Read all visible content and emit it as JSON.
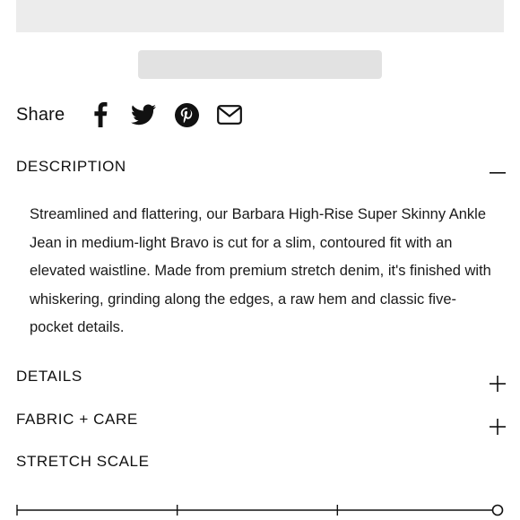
{
  "share": {
    "label": "Share",
    "icons": [
      "facebook-icon",
      "twitter-icon",
      "pinterest-icon",
      "email-icon"
    ]
  },
  "sections": {
    "description": {
      "title": "DESCRIPTION",
      "state": "expanded",
      "toggle_icon": "minus-icon",
      "body": "Streamlined and flattering, our Barbara High-Rise Super Skinny Ankle Jean in medium-light Bravo is cut for a slim, contoured fit with an elevated waistline. Made from premium stretch denim, it's finished with whiskering, grinding along the edges, a raw hem and classic five-pocket details."
    },
    "details": {
      "title": "DETAILS",
      "state": "collapsed",
      "toggle_icon": "plus-icon"
    },
    "fabric_care": {
      "title": "FABRIC + CARE",
      "state": "collapsed",
      "toggle_icon": "plus-icon"
    },
    "stretch_scale": {
      "title": "STRETCH SCALE",
      "steps": 4,
      "selected_step": 4
    }
  },
  "colors": {
    "text": "#111111",
    "placeholder": "#ececec"
  }
}
